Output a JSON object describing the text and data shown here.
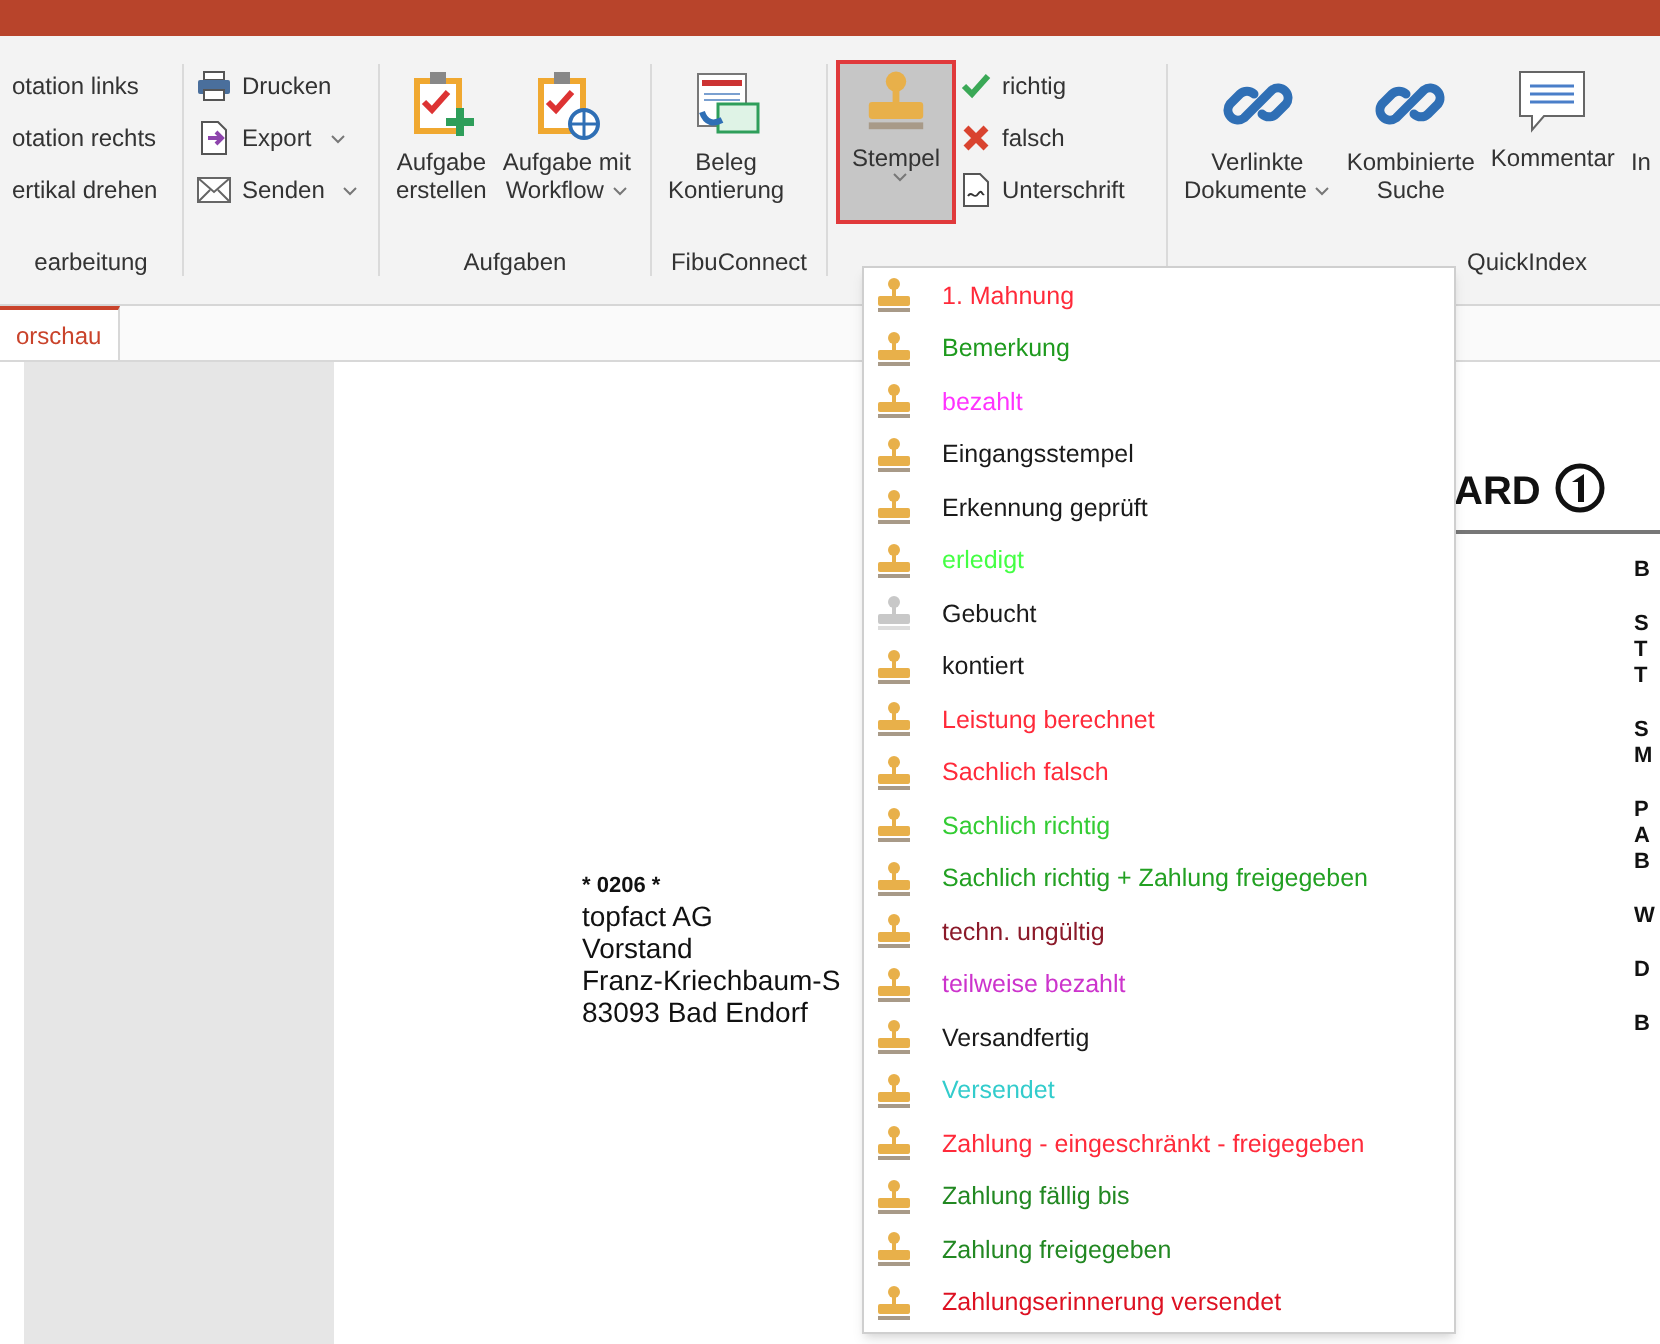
{
  "ribbon": {
    "groups": [
      {
        "label": "earbeitung",
        "small_buttons": [
          {
            "label": "otation links",
            "dropdown": false
          },
          {
            "label": "otation rechts",
            "dropdown": false
          },
          {
            "label": "ertikal drehen",
            "dropdown": false
          }
        ]
      },
      {
        "small_buttons": [
          {
            "label": "Drucken",
            "dropdown": false
          },
          {
            "label": "Export",
            "dropdown": true
          },
          {
            "label": "Senden",
            "dropdown": true
          }
        ]
      },
      {
        "label": "Aufgaben",
        "large_buttons": [
          {
            "lines": [
              "Aufgabe",
              "erstellen"
            ],
            "dropdown": false
          },
          {
            "lines": [
              "Aufgabe mit",
              "Workflow"
            ],
            "dropdown": true
          }
        ]
      },
      {
        "label": "FibuConnect",
        "large_buttons": [
          {
            "lines": [
              "Beleg",
              "Kontierung"
            ],
            "dropdown": false
          }
        ]
      },
      {
        "large_buttons": [
          {
            "lines": [
              "Stempel"
            ],
            "dropdown": true,
            "selected": true
          }
        ],
        "small_buttons": [
          {
            "label": "richtig",
            "dropdown": false
          },
          {
            "label": "falsch",
            "dropdown": false
          },
          {
            "label": "Unterschrift",
            "dropdown": false
          }
        ]
      },
      {
        "label": "QuickIndex",
        "large_buttons": [
          {
            "lines": [
              "Verlinkte",
              "Dokumente"
            ],
            "dropdown": true
          },
          {
            "lines": [
              "Kombinierte",
              "Suche"
            ],
            "dropdown": false
          },
          {
            "lines": [
              "Kommentar"
            ],
            "dropdown": false
          },
          {
            "lines": [
              "In"
            ],
            "dropdown": false
          }
        ]
      }
    ]
  },
  "tabs": [
    {
      "label": "orschau",
      "selected": true
    }
  ],
  "document": {
    "recipient": [
      "* 0206 *",
      "topfact AG",
      "Vorstand",
      "Franz-Kriechbaum-S",
      "83093 Bad Endorf"
    ],
    "logo": "ARD",
    "right_letters": [
      "B",
      "S",
      "T",
      "T",
      "S",
      "M",
      "P",
      "A",
      "B",
      "W",
      "D",
      "B"
    ]
  },
  "stamp_menu": [
    {
      "label": "1. Mahnung",
      "color": "#ff2a3a",
      "inactive": false
    },
    {
      "label": "Bemerkung",
      "color": "#1e9a1e",
      "inactive": false
    },
    {
      "label": "bezahlt",
      "color": "#ff33ff",
      "inactive": false
    },
    {
      "label": "Eingangsstempel",
      "color": "#1a1a1a",
      "inactive": false
    },
    {
      "label": "Erkennung geprüft",
      "color": "#1a1a1a",
      "inactive": false
    },
    {
      "label": "erledigt",
      "color": "#44ff44",
      "inactive": false
    },
    {
      "label": "Gebucht",
      "color": "#1a1a1a",
      "inactive": true
    },
    {
      "label": "kontiert",
      "color": "#1a1a1a",
      "inactive": false
    },
    {
      "label": "Leistung berechnet",
      "color": "#ff2a3a",
      "inactive": false
    },
    {
      "label": "Sachlich falsch",
      "color": "#ff2a3a",
      "inactive": false
    },
    {
      "label": "Sachlich richtig",
      "color": "#33cc33",
      "inactive": false
    },
    {
      "label": "Sachlich richtig + Zahlung freigegeben",
      "color": "#22a022",
      "inactive": false
    },
    {
      "label": "techn. ungültig",
      "color": "#8b1a2a",
      "inactive": false
    },
    {
      "label": "teilweise bezahlt",
      "color": "#cc33cc",
      "inactive": false
    },
    {
      "label": "Versandfertig",
      "color": "#1a1a1a",
      "inactive": false
    },
    {
      "label": "Versendet",
      "color": "#33cccc",
      "inactive": false
    },
    {
      "label": "Zahlung - eingeschränkt - freigegeben",
      "color": "#ff2a3a",
      "inactive": false
    },
    {
      "label": "Zahlung fällig bis",
      "color": "#228822",
      "inactive": false
    },
    {
      "label": "Zahlung freigegeben",
      "color": "#228822",
      "inactive": false
    },
    {
      "label": "Zahlungserinnerung versendet",
      "color": "#dd1122",
      "inactive": false
    }
  ]
}
